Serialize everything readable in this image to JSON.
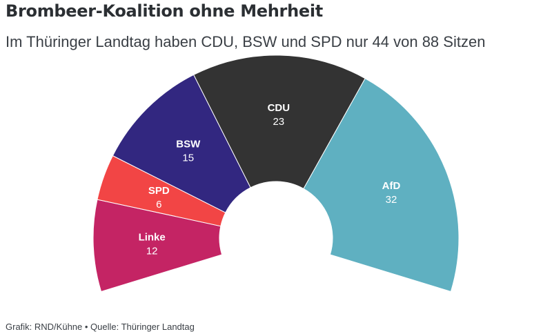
{
  "header": {
    "title": "Brombeer-Koalition ohne Mehrheit",
    "subtitle": "Im Thüringer Landtag haben CDU, BSW und SPD nur 44 von 88 Sitzen"
  },
  "footer": {
    "credit": "Grafik: RND/Kühne • Quelle: Thüringer Landtag"
  },
  "chart_data": {
    "type": "pie",
    "variant": "parliament-semicircle",
    "title": "Brombeer-Koalition ohne Mehrheit",
    "subtitle": "Im Thüringer Landtag haben CDU, BSW und SPD nur 44 von 88 Sitzen",
    "total": 88,
    "categories": [
      "Linke",
      "SPD",
      "BSW",
      "CDU",
      "AfD"
    ],
    "values": [
      12,
      6,
      15,
      23,
      32
    ],
    "colors": [
      "#c42464",
      "#f24545",
      "#322780",
      "#333333",
      "#5fb0c1"
    ],
    "label_color": "#ffffff",
    "legend": "none"
  }
}
